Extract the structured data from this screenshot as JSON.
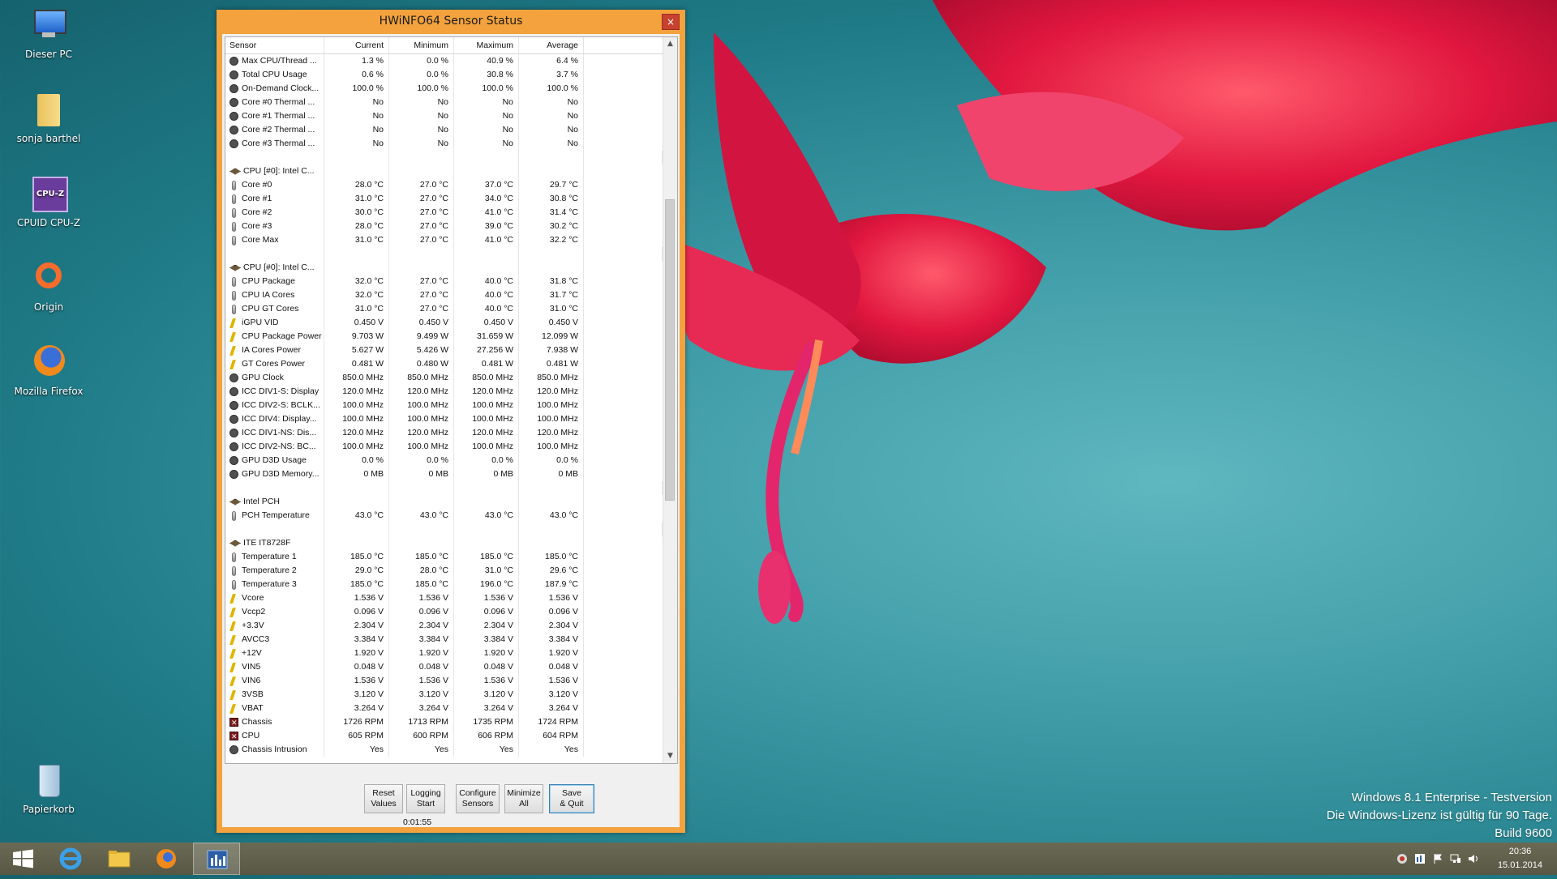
{
  "desktop": {
    "icons": [
      {
        "label": "Dieser PC",
        "icon": "computer-icon"
      },
      {
        "label": "sonja barthel",
        "icon": "user-folder-icon"
      },
      {
        "label": "CPUID CPU-Z",
        "icon": "cpuz-icon"
      },
      {
        "label": "Origin",
        "icon": "origin-icon"
      },
      {
        "label": "Mozilla Firefox",
        "icon": "firefox-icon"
      },
      {
        "label": "Papierkorb",
        "icon": "recycle-bin-icon"
      }
    ],
    "watermark": {
      "line1": "Windows 8.1 Enterprise - Testversion",
      "line2": "Die Windows-Lizenz ist gültig für 90 Tage.",
      "line3": "Build 9600"
    }
  },
  "window": {
    "title": "HWiNFO64 Sensor Status",
    "close_label": "×",
    "accent": "#f3a23d",
    "columns": [
      "Sensor",
      "Current",
      "Minimum",
      "Maximum",
      "Average"
    ],
    "rows": [
      {
        "icon": "dot",
        "name": "Max CPU/Thread ...",
        "cur": "1.3 %",
        "min": "0.0 %",
        "max": "40.9 %",
        "avg": "6.4 %"
      },
      {
        "icon": "dot",
        "name": "Total CPU Usage",
        "cur": "0.6 %",
        "min": "0.0 %",
        "max": "30.8 %",
        "avg": "3.7 %"
      },
      {
        "icon": "dot",
        "name": "On-Demand Clock...",
        "cur": "100.0 %",
        "min": "100.0 %",
        "max": "100.0 %",
        "avg": "100.0 %"
      },
      {
        "icon": "dot",
        "name": "Core #0 Thermal ...",
        "cur": "No",
        "min": "No",
        "max": "No",
        "avg": "No"
      },
      {
        "icon": "dot",
        "name": "Core #1 Thermal ...",
        "cur": "No",
        "min": "No",
        "max": "No",
        "avg": "No"
      },
      {
        "icon": "dot",
        "name": "Core #2 Thermal ...",
        "cur": "No",
        "min": "No",
        "max": "No",
        "avg": "No"
      },
      {
        "icon": "dot",
        "name": "Core #3 Thermal ...",
        "cur": "No",
        "min": "No",
        "max": "No",
        "avg": "No"
      },
      {
        "icon": "blank",
        "name": "",
        "cur": "",
        "min": "",
        "max": "",
        "avg": ""
      },
      {
        "icon": "chip",
        "name": "CPU [#0]: Intel C...",
        "cur": "",
        "min": "",
        "max": "",
        "avg": ""
      },
      {
        "icon": "therm",
        "name": "Core #0",
        "cur": "28.0 °C",
        "min": "27.0 °C",
        "max": "37.0 °C",
        "avg": "29.7 °C"
      },
      {
        "icon": "therm",
        "name": "Core #1",
        "cur": "31.0 °C",
        "min": "27.0 °C",
        "max": "34.0 °C",
        "avg": "30.8 °C"
      },
      {
        "icon": "therm",
        "name": "Core #2",
        "cur": "30.0 °C",
        "min": "27.0 °C",
        "max": "41.0 °C",
        "avg": "31.4 °C"
      },
      {
        "icon": "therm",
        "name": "Core #3",
        "cur": "28.0 °C",
        "min": "27.0 °C",
        "max": "39.0 °C",
        "avg": "30.2 °C"
      },
      {
        "icon": "therm",
        "name": "Core Max",
        "cur": "31.0 °C",
        "min": "27.0 °C",
        "max": "41.0 °C",
        "avg": "32.2 °C"
      },
      {
        "icon": "blank",
        "name": "",
        "cur": "",
        "min": "",
        "max": "",
        "avg": ""
      },
      {
        "icon": "chip",
        "name": "CPU [#0]: Intel C...",
        "cur": "",
        "min": "",
        "max": "",
        "avg": ""
      },
      {
        "icon": "therm",
        "name": "CPU Package",
        "cur": "32.0 °C",
        "min": "27.0 °C",
        "max": "40.0 °C",
        "avg": "31.8 °C"
      },
      {
        "icon": "therm",
        "name": "CPU IA Cores",
        "cur": "32.0 °C",
        "min": "27.0 °C",
        "max": "40.0 °C",
        "avg": "31.7 °C"
      },
      {
        "icon": "therm",
        "name": "CPU GT Cores",
        "cur": "31.0 °C",
        "min": "27.0 °C",
        "max": "40.0 °C",
        "avg": "31.0 °C"
      },
      {
        "icon": "volt",
        "name": "iGPU VID",
        "cur": "0.450 V",
        "min": "0.450 V",
        "max": "0.450 V",
        "avg": "0.450 V"
      },
      {
        "icon": "volt",
        "name": "CPU Package Power",
        "cur": "9.703 W",
        "min": "9.499 W",
        "max": "31.659 W",
        "avg": "12.099 W"
      },
      {
        "icon": "volt",
        "name": "IA Cores Power",
        "cur": "5.627 W",
        "min": "5.426 W",
        "max": "27.256 W",
        "avg": "7.938 W"
      },
      {
        "icon": "volt",
        "name": "GT Cores Power",
        "cur": "0.481 W",
        "min": "0.480 W",
        "max": "0.481 W",
        "avg": "0.481 W"
      },
      {
        "icon": "dot",
        "name": "GPU Clock",
        "cur": "850.0 MHz",
        "min": "850.0 MHz",
        "max": "850.0 MHz",
        "avg": "850.0 MHz"
      },
      {
        "icon": "dot",
        "name": "ICC DIV1-S: Display",
        "cur": "120.0 MHz",
        "min": "120.0 MHz",
        "max": "120.0 MHz",
        "avg": "120.0 MHz"
      },
      {
        "icon": "dot",
        "name": "ICC DIV2-S: BCLK...",
        "cur": "100.0 MHz",
        "min": "100.0 MHz",
        "max": "100.0 MHz",
        "avg": "100.0 MHz"
      },
      {
        "icon": "dot",
        "name": "ICC DIV4: Display...",
        "cur": "100.0 MHz",
        "min": "100.0 MHz",
        "max": "100.0 MHz",
        "avg": "100.0 MHz"
      },
      {
        "icon": "dot",
        "name": "ICC DIV1-NS: Dis...",
        "cur": "120.0 MHz",
        "min": "120.0 MHz",
        "max": "120.0 MHz",
        "avg": "120.0 MHz"
      },
      {
        "icon": "dot",
        "name": "ICC DIV2-NS: BC...",
        "cur": "100.0 MHz",
        "min": "100.0 MHz",
        "max": "100.0 MHz",
        "avg": "100.0 MHz"
      },
      {
        "icon": "dot",
        "name": "GPU D3D Usage",
        "cur": "0.0 %",
        "min": "0.0 %",
        "max": "0.0 %",
        "avg": "0.0 %"
      },
      {
        "icon": "dot",
        "name": "GPU D3D Memory...",
        "cur": "0 MB",
        "min": "0 MB",
        "max": "0 MB",
        "avg": "0 MB"
      },
      {
        "icon": "blank",
        "name": "",
        "cur": "",
        "min": "",
        "max": "",
        "avg": ""
      },
      {
        "icon": "chip",
        "name": "Intel PCH",
        "cur": "",
        "min": "",
        "max": "",
        "avg": ""
      },
      {
        "icon": "therm",
        "name": "PCH Temperature",
        "cur": "43.0 °C",
        "min": "43.0 °C",
        "max": "43.0 °C",
        "avg": "43.0 °C"
      },
      {
        "icon": "blank",
        "name": "",
        "cur": "",
        "min": "",
        "max": "",
        "avg": ""
      },
      {
        "icon": "chip",
        "name": "ITE IT8728F",
        "cur": "",
        "min": "",
        "max": "",
        "avg": ""
      },
      {
        "icon": "therm",
        "name": "Temperature 1",
        "cur": "185.0 °C",
        "min": "185.0 °C",
        "max": "185.0 °C",
        "avg": "185.0 °C"
      },
      {
        "icon": "therm",
        "name": "Temperature 2",
        "cur": "29.0 °C",
        "min": "28.0 °C",
        "max": "31.0 °C",
        "avg": "29.6 °C"
      },
      {
        "icon": "therm",
        "name": "Temperature 3",
        "cur": "185.0 °C",
        "min": "185.0 °C",
        "max": "196.0 °C",
        "avg": "187.9 °C"
      },
      {
        "icon": "volt",
        "name": "Vcore",
        "cur": "1.536 V",
        "min": "1.536 V",
        "max": "1.536 V",
        "avg": "1.536 V"
      },
      {
        "icon": "volt",
        "name": "Vccp2",
        "cur": "0.096 V",
        "min": "0.096 V",
        "max": "0.096 V",
        "avg": "0.096 V"
      },
      {
        "icon": "volt",
        "name": "+3.3V",
        "cur": "2.304 V",
        "min": "2.304 V",
        "max": "2.304 V",
        "avg": "2.304 V"
      },
      {
        "icon": "volt",
        "name": "AVCC3",
        "cur": "3.384 V",
        "min": "3.384 V",
        "max": "3.384 V",
        "avg": "3.384 V"
      },
      {
        "icon": "volt",
        "name": "+12V",
        "cur": "1.920 V",
        "min": "1.920 V",
        "max": "1.920 V",
        "avg": "1.920 V"
      },
      {
        "icon": "volt",
        "name": "VIN5",
        "cur": "0.048 V",
        "min": "0.048 V",
        "max": "0.048 V",
        "avg": "0.048 V"
      },
      {
        "icon": "volt",
        "name": "VIN6",
        "cur": "1.536 V",
        "min": "1.536 V",
        "max": "1.536 V",
        "avg": "1.536 V"
      },
      {
        "icon": "volt",
        "name": "3VSB",
        "cur": "3.120 V",
        "min": "3.120 V",
        "max": "3.120 V",
        "avg": "3.120 V"
      },
      {
        "icon": "volt",
        "name": "VBAT",
        "cur": "3.264 V",
        "min": "3.264 V",
        "max": "3.264 V",
        "avg": "3.264 V"
      },
      {
        "icon": "fan",
        "name": "Chassis",
        "cur": "1726 RPM",
        "min": "1713 RPM",
        "max": "1735 RPM",
        "avg": "1724 RPM"
      },
      {
        "icon": "fan",
        "name": "CPU",
        "cur": "605 RPM",
        "min": "600 RPM",
        "max": "606 RPM",
        "avg": "604 RPM"
      },
      {
        "icon": "dot",
        "name": "Chassis Intrusion",
        "cur": "Yes",
        "min": "Yes",
        "max": "Yes",
        "avg": "Yes"
      }
    ],
    "buttons": {
      "reset": "Reset\nValues",
      "logging": "Logging\nStart",
      "configure": "Configure\nSensors",
      "minimize": "Minimize\nAll",
      "save": "Save\n& Quit"
    },
    "elapsed": "0:01:55"
  },
  "taskbar": {
    "pinned": [
      "windows-start-icon",
      "internet-explorer-icon",
      "file-explorer-icon",
      "firefox-icon",
      "hwinfo-icon"
    ],
    "clock": {
      "time": "20:36",
      "date": "15.01.2014"
    }
  }
}
